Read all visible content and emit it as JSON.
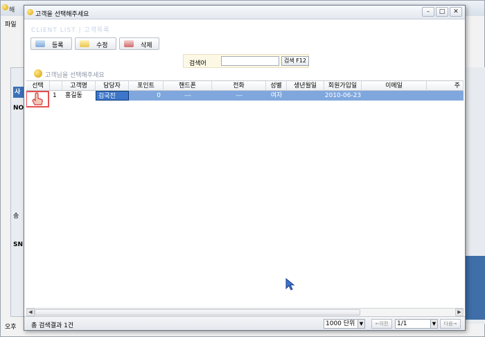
{
  "background_window": {
    "title": "해",
    "menu": "파일",
    "side_labels": [
      "사",
      "NO",
      "송",
      "SN"
    ],
    "status_left": "오후"
  },
  "dialog": {
    "title": "고객을 선택해주세요",
    "window_buttons": {
      "minimize": "–",
      "maximize": "□",
      "close": "✕"
    },
    "section_title": "CLIENT LIST | 고객목록",
    "toolbar": {
      "register": "등록",
      "edit": "수정",
      "delete": "삭제"
    },
    "search": {
      "label": "검색어",
      "value": "",
      "button": "검색 F12"
    },
    "hint": "고객님을 선택해주세요"
  },
  "grid": {
    "columns": [
      "선택",
      "",
      "고객명",
      "담당자",
      "포인트",
      "핸드폰",
      "전화",
      "성별",
      "생년월일",
      "회원가입일",
      "이메일",
      "주"
    ],
    "rows": [
      {
        "no": "1",
        "name": "홍길동",
        "manager": "김국진",
        "points": "0",
        "mobile": "---",
        "phone": "---",
        "gender": "여자",
        "birthday": "",
        "join_date": "2010-06-23",
        "email": "",
        "addr": ""
      }
    ]
  },
  "hscroll": {
    "left": "◀",
    "right": "▶"
  },
  "statusbar": {
    "result": "총 검색결과 1건",
    "page_size": "1000 단위",
    "prev": "←이전",
    "page": "1/1",
    "next": "다음→",
    "dropdown_arrow": "▼"
  },
  "colors": {
    "selected_row": "#7fa7dd",
    "edit_cell": "#3d76c8",
    "highlight_box": "#e45050"
  }
}
